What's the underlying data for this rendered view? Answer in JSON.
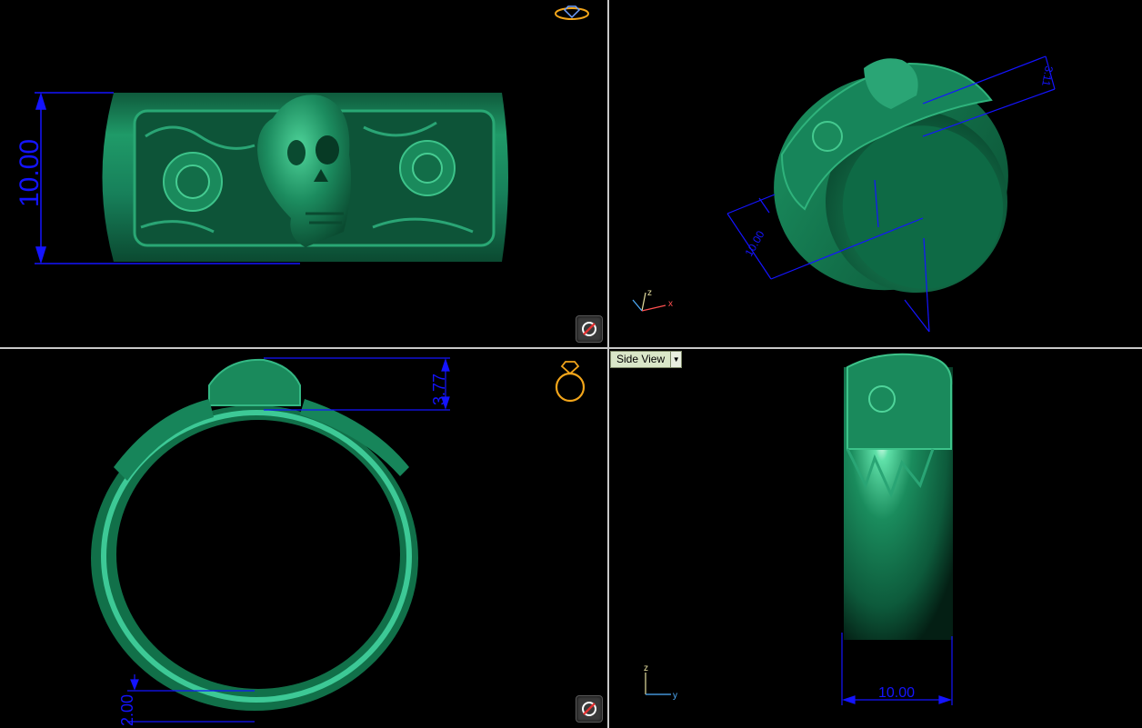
{
  "viewports": {
    "top": {
      "dimension": "10.00"
    },
    "perspective": {
      "dimension_width": "10.00",
      "dimension_height": "3.11",
      "axes": {
        "z": "z",
        "x": "x"
      }
    },
    "front": {
      "dimension_height": "3.77",
      "dimension_band": "2.00"
    },
    "side": {
      "label": "Side View",
      "dimension_width": "10.00",
      "axes": {
        "z": "z",
        "y": "y"
      }
    }
  },
  "colors": {
    "ring": "#1b8a5e",
    "dimension": "#1414ff",
    "divider": "#c8c8c8",
    "icon": "#f2a51a"
  },
  "icons": {
    "top_corner": "ring-top-icon",
    "front_corner": "ring-front-icon",
    "orbit": "orbit-icon"
  }
}
